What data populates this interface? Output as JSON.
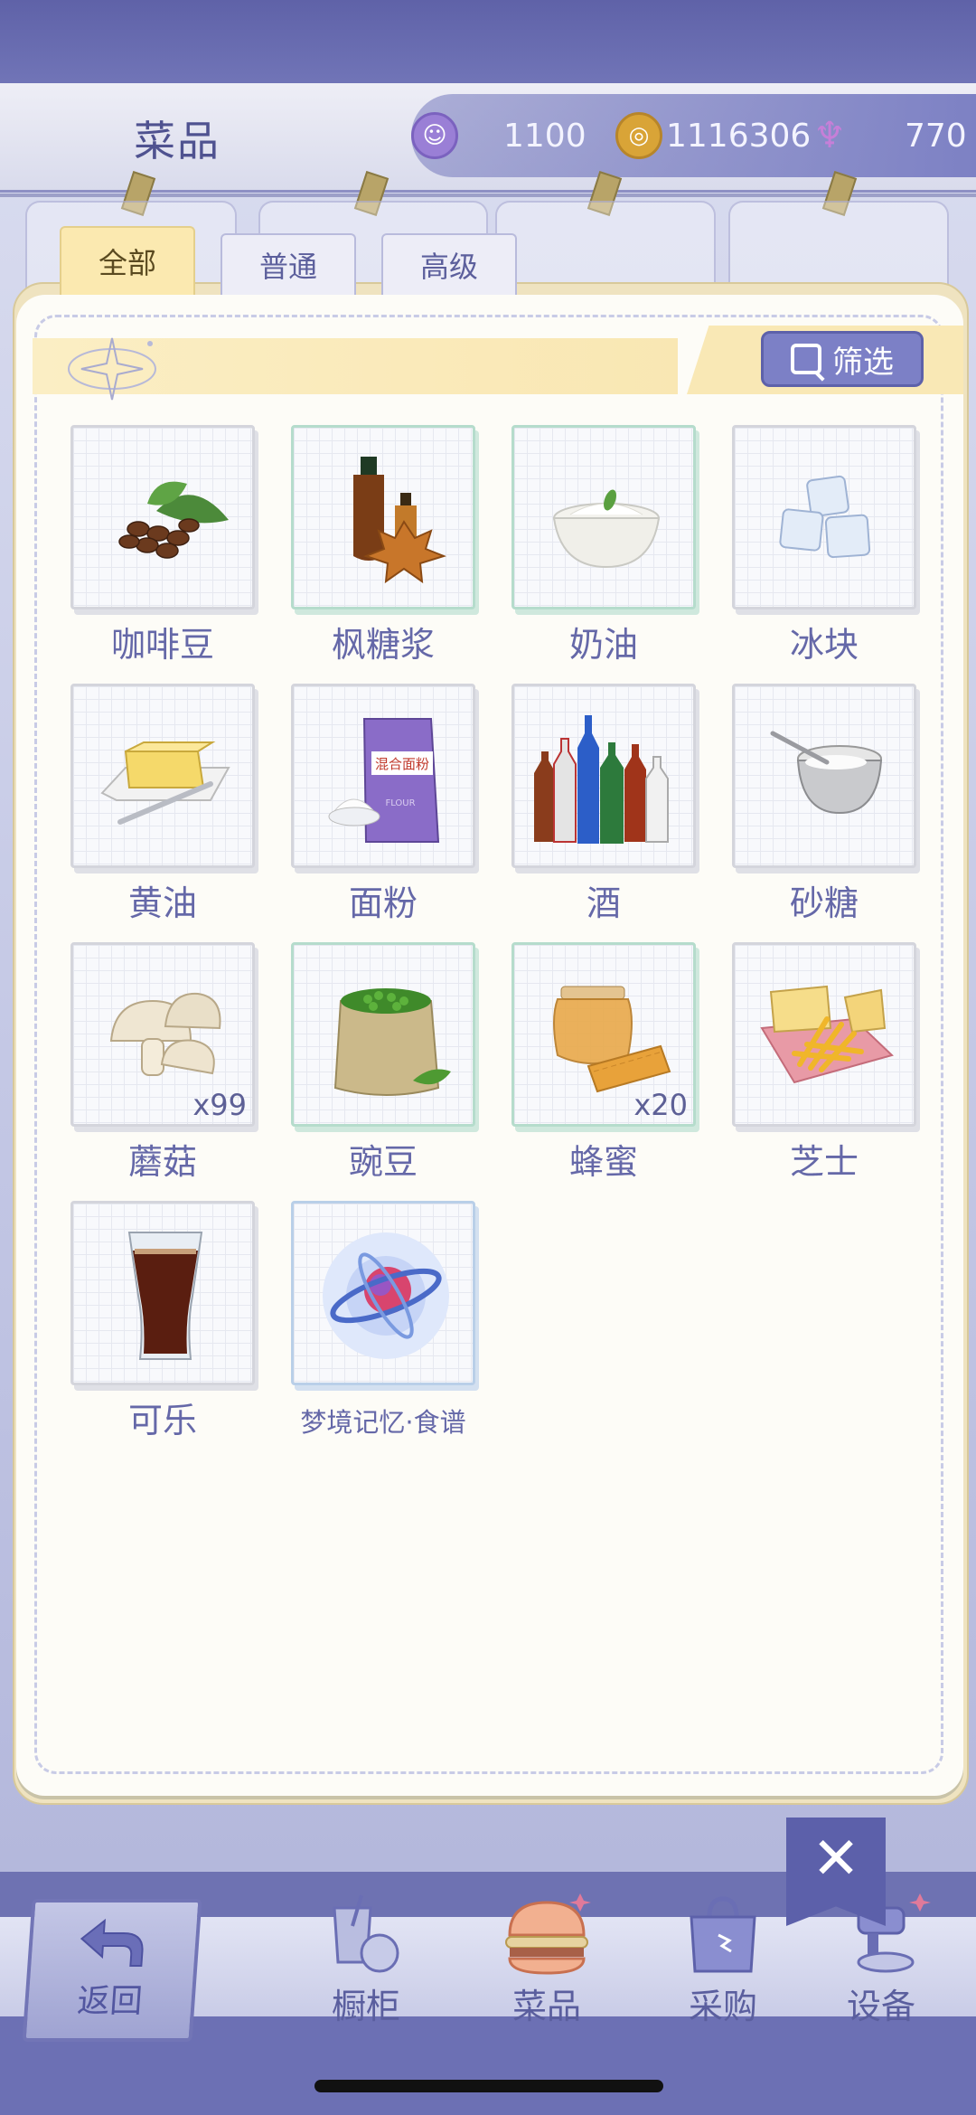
{
  "header": {
    "title": "菜品",
    "currencies": [
      {
        "icon": "purple-coin-icon",
        "value": "1100",
        "color": "#9a7fd6"
      },
      {
        "icon": "gold-coin-icon",
        "value": "1116306",
        "color": "#d9a437"
      },
      {
        "icon": "swan-energy-icon",
        "value": "770",
        "color": "#c67fd8"
      }
    ]
  },
  "tabs": [
    {
      "label": "全部",
      "active": true
    },
    {
      "label": "普通",
      "active": false
    },
    {
      "label": "高级",
      "active": false
    }
  ],
  "filter": {
    "label": "筛选"
  },
  "items": [
    {
      "name": "咖啡豆",
      "count": "",
      "icon": "coffee-beans-icon"
    },
    {
      "name": "枫糖浆",
      "count": "",
      "icon": "maple-syrup-icon"
    },
    {
      "name": "奶油",
      "count": "",
      "icon": "cream-icon"
    },
    {
      "name": "冰块",
      "count": "",
      "icon": "ice-cubes-icon"
    },
    {
      "name": "黄油",
      "count": "",
      "icon": "butter-icon"
    },
    {
      "name": "面粉",
      "count": "",
      "icon": "flour-icon"
    },
    {
      "name": "酒",
      "count": "",
      "icon": "liquor-bottles-icon"
    },
    {
      "name": "砂糖",
      "count": "",
      "icon": "sugar-pot-icon"
    },
    {
      "name": "蘑菇",
      "count": "x99",
      "icon": "mushroom-icon"
    },
    {
      "name": "豌豆",
      "count": "",
      "icon": "peas-icon"
    },
    {
      "name": "蜂蜜",
      "count": "x20",
      "icon": "honey-icon"
    },
    {
      "name": "芝士",
      "count": "",
      "icon": "cheese-fries-icon"
    },
    {
      "name": "可乐",
      "count": "",
      "icon": "cola-glass-icon"
    },
    {
      "name": "梦境记忆·食谱",
      "count": "",
      "icon": "dream-memory-orb-icon"
    }
  ],
  "nav": {
    "back": "返回",
    "items": [
      {
        "label": "橱柜",
        "icon": "cabinet-drink-icon"
      },
      {
        "label": "菜品",
        "icon": "burger-icon"
      },
      {
        "label": "采购",
        "icon": "shopping-bag-icon"
      },
      {
        "label": "设备",
        "icon": "mixer-device-icon"
      }
    ]
  }
}
